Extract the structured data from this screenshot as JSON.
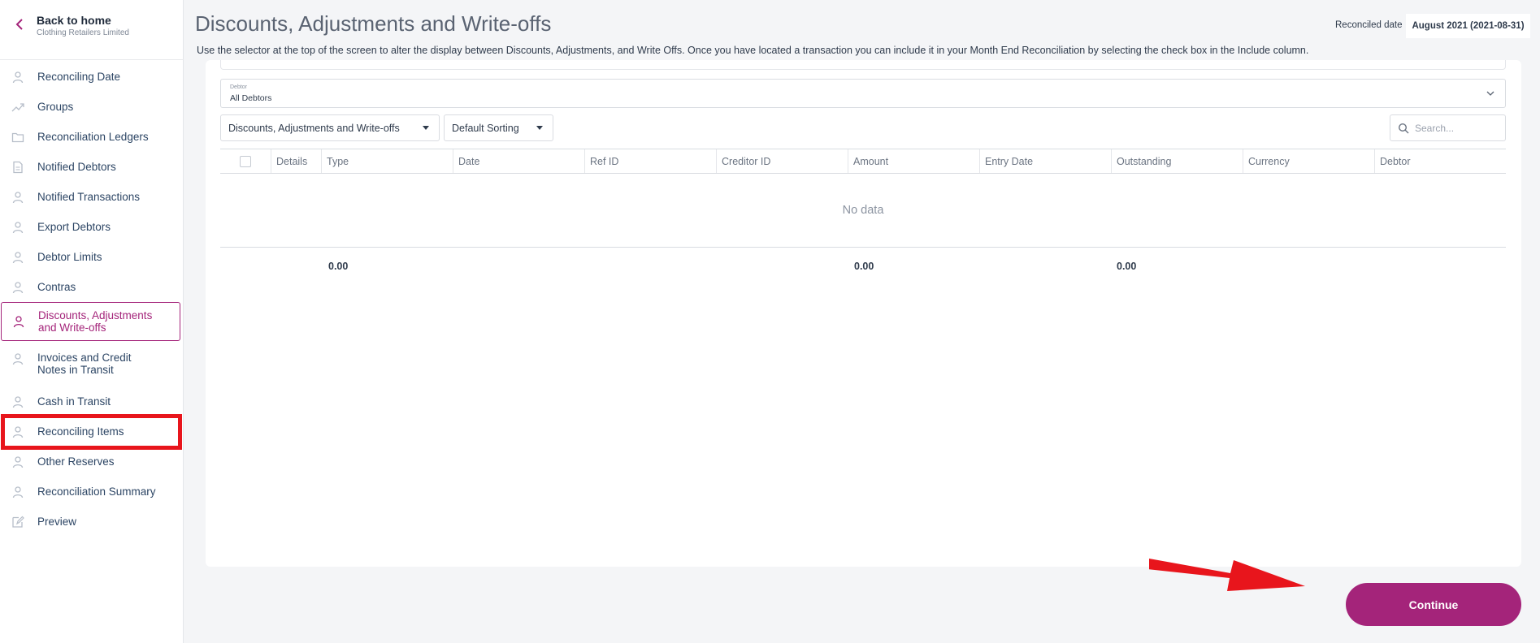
{
  "sidebar": {
    "back_title": "Back to home",
    "back_subtitle": "Clothing Retailers Limited",
    "items": [
      {
        "label": "Reconciling Date",
        "icon": "user-icon"
      },
      {
        "label": "Groups",
        "icon": "trend-icon"
      },
      {
        "label": "Reconciliation Ledgers",
        "icon": "folder-icon"
      },
      {
        "label": "Notified Debtors",
        "icon": "document-icon"
      },
      {
        "label": "Notified Transactions",
        "icon": "user-icon"
      },
      {
        "label": "Export Debtors",
        "icon": "user-icon"
      },
      {
        "label": "Debtor Limits",
        "icon": "user-icon"
      },
      {
        "label": "Contras",
        "icon": "user-icon"
      },
      {
        "label": "Discounts, Adjustments and Write-offs",
        "icon": "user-icon",
        "active": true
      },
      {
        "label": "Invoices and Credit Notes in Transit",
        "icon": "user-icon"
      },
      {
        "label": "Cash in Transit",
        "icon": "user-icon"
      },
      {
        "label": "Reconciling Items",
        "icon": "user-icon",
        "highlighted": true
      },
      {
        "label": "Other Reserves",
        "icon": "user-icon"
      },
      {
        "label": "Reconciliation Summary",
        "icon": "user-icon"
      },
      {
        "label": "Preview",
        "icon": "edit-icon"
      }
    ]
  },
  "header": {
    "title": "Discounts, Adjustments and Write-offs",
    "description": "Use the selector at the top of the screen to alter the display between Discounts, Adjustments, and Write Offs. Once you have located a transaction you can include it in your Month End Reconciliation by selecting the check box in the Include column.",
    "reconciled_label": "Reconciled date",
    "reconciled_value": "August 2021 (2021-08-31)"
  },
  "filters": {
    "debtor_label": "Debtor",
    "debtor_value": "All Debtors",
    "type_select": "Discounts, Adjustments and Write-offs",
    "sort_select": "Default Sorting",
    "search_placeholder": "Search..."
  },
  "table": {
    "columns": [
      "Details",
      "Type",
      "Date",
      "Ref ID",
      "Creditor ID",
      "Amount",
      "Entry Date",
      "Outstanding",
      "Currency",
      "Debtor"
    ],
    "empty_text": "No data",
    "totals": {
      "type": "0.00",
      "amount": "0.00",
      "outstanding": "0.00"
    }
  },
  "actions": {
    "continue_label": "Continue"
  },
  "colors": {
    "accent": "#a4247a",
    "annotation_red": "#e8151c"
  }
}
